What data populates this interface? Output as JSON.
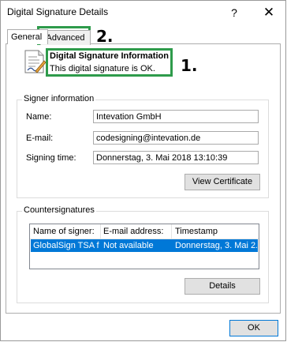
{
  "window": {
    "title": "Digital Signature Details",
    "help_glyph": "?",
    "close_glyph": "✕"
  },
  "tabs": [
    {
      "label": "General"
    },
    {
      "label": "Advanced"
    }
  ],
  "info": {
    "title": "Digital Signature Information",
    "text": "This digital signature is OK."
  },
  "signer": {
    "group_label": "Signer information",
    "name_label": "Name:",
    "name_value": "Intevation GmbH",
    "email_label": "E-mail:",
    "email_value": "codesigning@intevation.de",
    "time_label": "Signing time:",
    "time_value": "Donnerstag, 3. Mai 2018 13:10:39",
    "view_cert_label": "View Certificate"
  },
  "countersignatures": {
    "group_label": "Countersignatures",
    "columns": [
      "Name of signer:",
      "E-mail address:",
      "Timestamp"
    ],
    "rows": [
      [
        "GlobalSign TSA f...",
        "Not available",
        "Donnerstag, 3. Mai 2..."
      ]
    ],
    "details_label": "Details"
  },
  "footer": {
    "ok_label": "OK"
  },
  "annotations": [
    {
      "label": "1."
    },
    {
      "label": "2."
    }
  ],
  "colors": {
    "selection": "#0078d7",
    "annotation": "#2e9b4b"
  },
  "icons": {
    "certificate": "certificate-document-icon"
  }
}
